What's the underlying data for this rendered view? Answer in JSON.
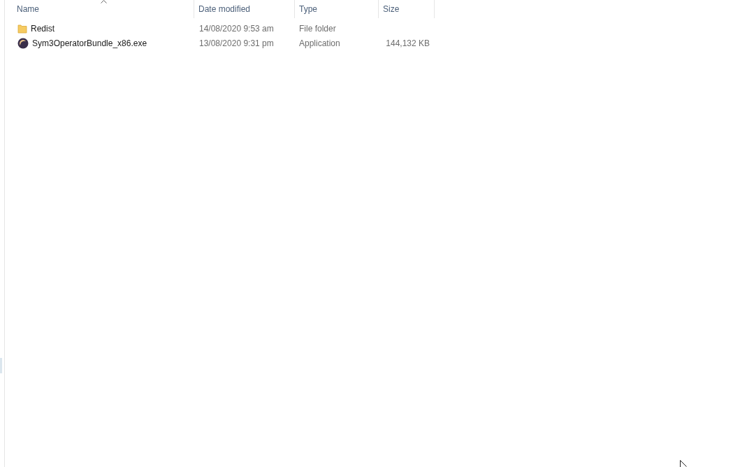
{
  "columns": [
    {
      "label": "Name",
      "sorted": true
    },
    {
      "label": "Date modified",
      "sorted": false
    },
    {
      "label": "Type",
      "sorted": false
    },
    {
      "label": "Size",
      "sorted": false
    }
  ],
  "rows": [
    {
      "kind": "folder",
      "name": "Redist",
      "date_modified": "14/08/2020 9:53 am",
      "type": "File folder"
    },
    {
      "kind": "application",
      "name": "Sym3OperatorBundle_x86.exe",
      "date_modified": "13/08/2020 9:31 pm",
      "type": "Application",
      "size": "144,132 KB"
    }
  ]
}
